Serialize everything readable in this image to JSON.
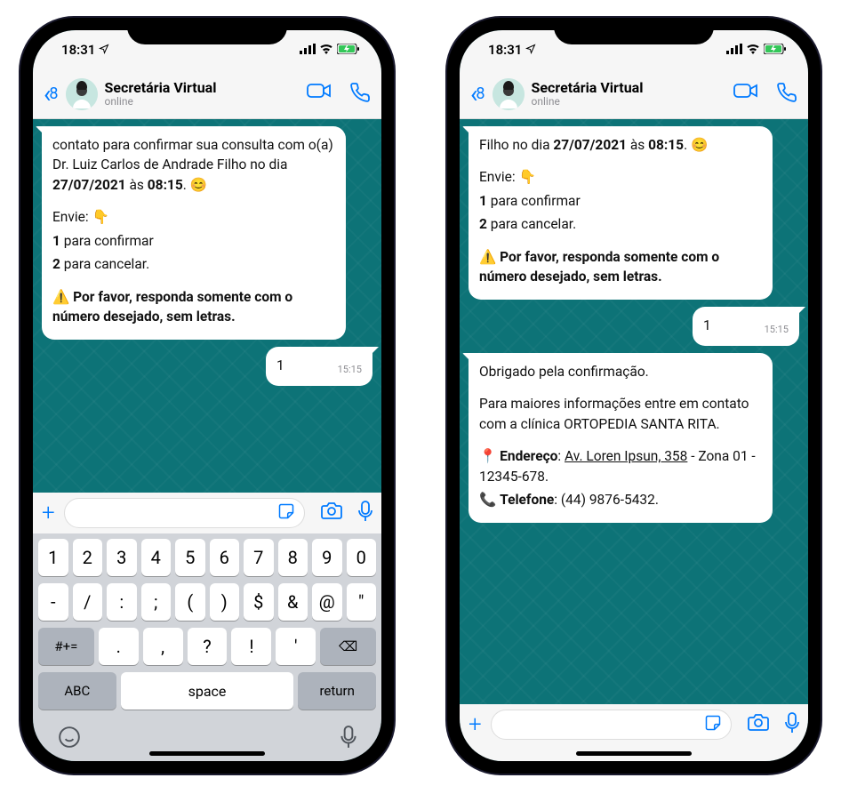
{
  "status": {
    "time": "18:31",
    "loc_icon": "location-arrow"
  },
  "header": {
    "back_count": "8",
    "contact_name": "Secretária Virtual",
    "contact_status": "online"
  },
  "phone1": {
    "msg1": {
      "pre": "contato para confirmar sua consulta com o(a) Dr. Luiz Carlos de Andrade Filho no dia ",
      "date": "27/07/2021",
      "mid": " às ",
      "hour": "08:15",
      "post": ". 😊",
      "envie": "Envie: 👇",
      "opt1_b": "1",
      "opt1_t": " para confirmar",
      "opt2_b": "2",
      "opt2_t": " para cancelar.",
      "warn": "⚠️ Por favor, responda somente com o número desejado, sem letras."
    },
    "reply": {
      "text": "1",
      "time": "15:15"
    }
  },
  "phone2": {
    "msg1": {
      "pre": "Filho no dia ",
      "date": "27/07/2021",
      "mid": " às ",
      "hour": "08:15",
      "post": ". 😊",
      "envie": "Envie: 👇",
      "opt1_b": "1",
      "opt1_t": " para confirmar",
      "opt2_b": "2",
      "opt2_t": " para cancelar.",
      "warn": "⚠️ Por favor, responda somente com o número desejado, sem letras."
    },
    "reply": {
      "text": "1",
      "time": "15:15"
    },
    "msg2": {
      "l1": "Obrigado pela confirmação.",
      "l2": "Para maiores informações entre em contato com a clínica ORTOPEDIA SANTA RITA.",
      "addr_icon": "📍",
      "addr_label": "Endereço",
      "addr_link": "Av. Loren Ipsun, 358",
      "addr_rest": " - Zona 01 - 12345-678.",
      "tel_icon": "📞",
      "tel_label": "Telefone",
      "tel_val": ": (44) 9876-5432."
    }
  },
  "keyboard": {
    "row1": [
      "1",
      "2",
      "3",
      "4",
      "5",
      "6",
      "7",
      "8",
      "9",
      "0"
    ],
    "row2": [
      "-",
      "/",
      ":",
      ";",
      "(",
      ")",
      "$",
      "&",
      "@",
      "\""
    ],
    "sym": "#+=",
    "row3": [
      ".",
      ",",
      "?",
      "!",
      "'"
    ],
    "bksp": "⌫",
    "abc": "ABC",
    "space": "space",
    "ret": "return"
  }
}
